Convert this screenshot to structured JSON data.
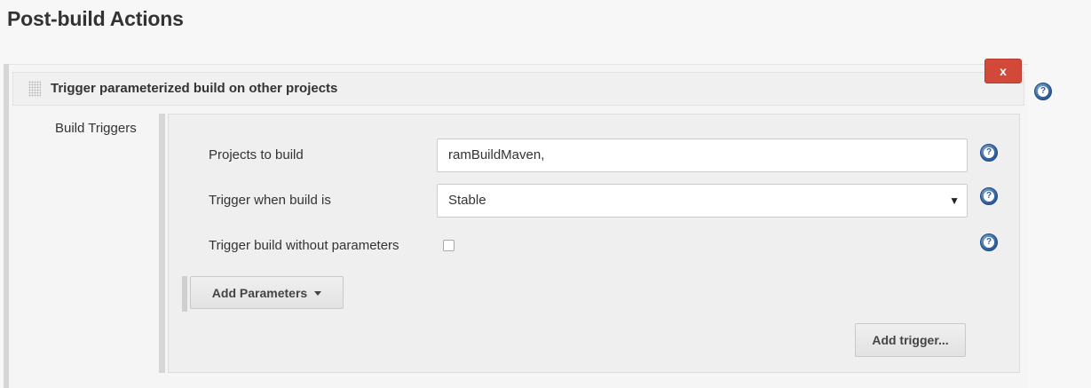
{
  "section": {
    "title": "Post-build Actions"
  },
  "block": {
    "title": "Trigger parameterized build on other projects",
    "delete_label": "x",
    "build_triggers_label": "Build Triggers"
  },
  "form": {
    "projects_label": "Projects to build",
    "projects_value": "ramBuildMaven,",
    "trigger_label": "Trigger when build is",
    "trigger_selected": "Stable",
    "no_params_label": "Trigger build without parameters",
    "no_params_checked": false
  },
  "buttons": {
    "add_parameters": "Add Parameters",
    "add_trigger": "Add trigger..."
  },
  "icons": {
    "help": "help-icon",
    "drag": "drag-handle-icon",
    "dropdown": "chevron-down-icon"
  },
  "colors": {
    "delete_red": "#d24939",
    "help_blue": "#2d5c99"
  }
}
